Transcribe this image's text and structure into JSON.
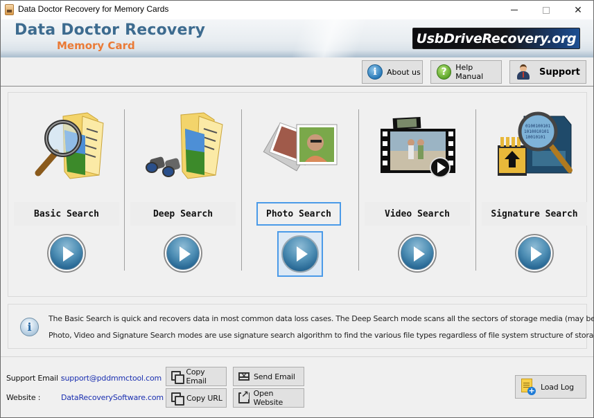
{
  "window": {
    "title": "Data Doctor Recovery for Memory Cards",
    "controls": {
      "minimize": "minimize",
      "maximize": "maximize",
      "close": "close"
    }
  },
  "banner": {
    "title": "Data Doctor Recovery",
    "subtitle": "Memory Card",
    "site_badge": "UsbDriveRecovery.org",
    "colors": {
      "title": "#3d6b8f",
      "subtitle": "#ea7a36"
    }
  },
  "toolbar": {
    "buttons": [
      {
        "label": "About us",
        "icon": "info-icon"
      },
      {
        "label": "Help Manual",
        "icon": "help-icon"
      },
      {
        "label": "Support",
        "icon": "user-icon"
      }
    ]
  },
  "modes": [
    {
      "label": "Basic Search",
      "icon": "magnifier-folder-icon",
      "focused": false
    },
    {
      "label": "Deep Search",
      "icon": "binoculars-folder-icon",
      "focused": false
    },
    {
      "label": "Photo Search",
      "icon": "photos-icon",
      "focused": true
    },
    {
      "label": "Video Search",
      "icon": "film-icon",
      "focused": false
    },
    {
      "label": "Signature Search",
      "icon": "memory-card-magnifier-icon",
      "focused": false
    }
  ],
  "info": {
    "line1": "The Basic Search is quick and recovers data in most common data loss cases. The Deep Search mode scans all the sectors of storage media (may be slower).",
    "line2": "Photo, Video and Signature Search modes are use signature search algorithm to find the various file types regardless of file system structure of storage media."
  },
  "footer": {
    "support_email_label": "Support Email :",
    "support_email": "support@pddmmctool.com",
    "website_label": "Website :",
    "website": "DataRecoverySoftware.com",
    "copy_email": "Copy Email",
    "send_email": "Send Email",
    "copy_url": "Copy URL",
    "open_website": "Open Website",
    "load_log": "Load Log",
    "link_color": "#1a2fb0",
    "focus_color": "#4a9ae8"
  }
}
